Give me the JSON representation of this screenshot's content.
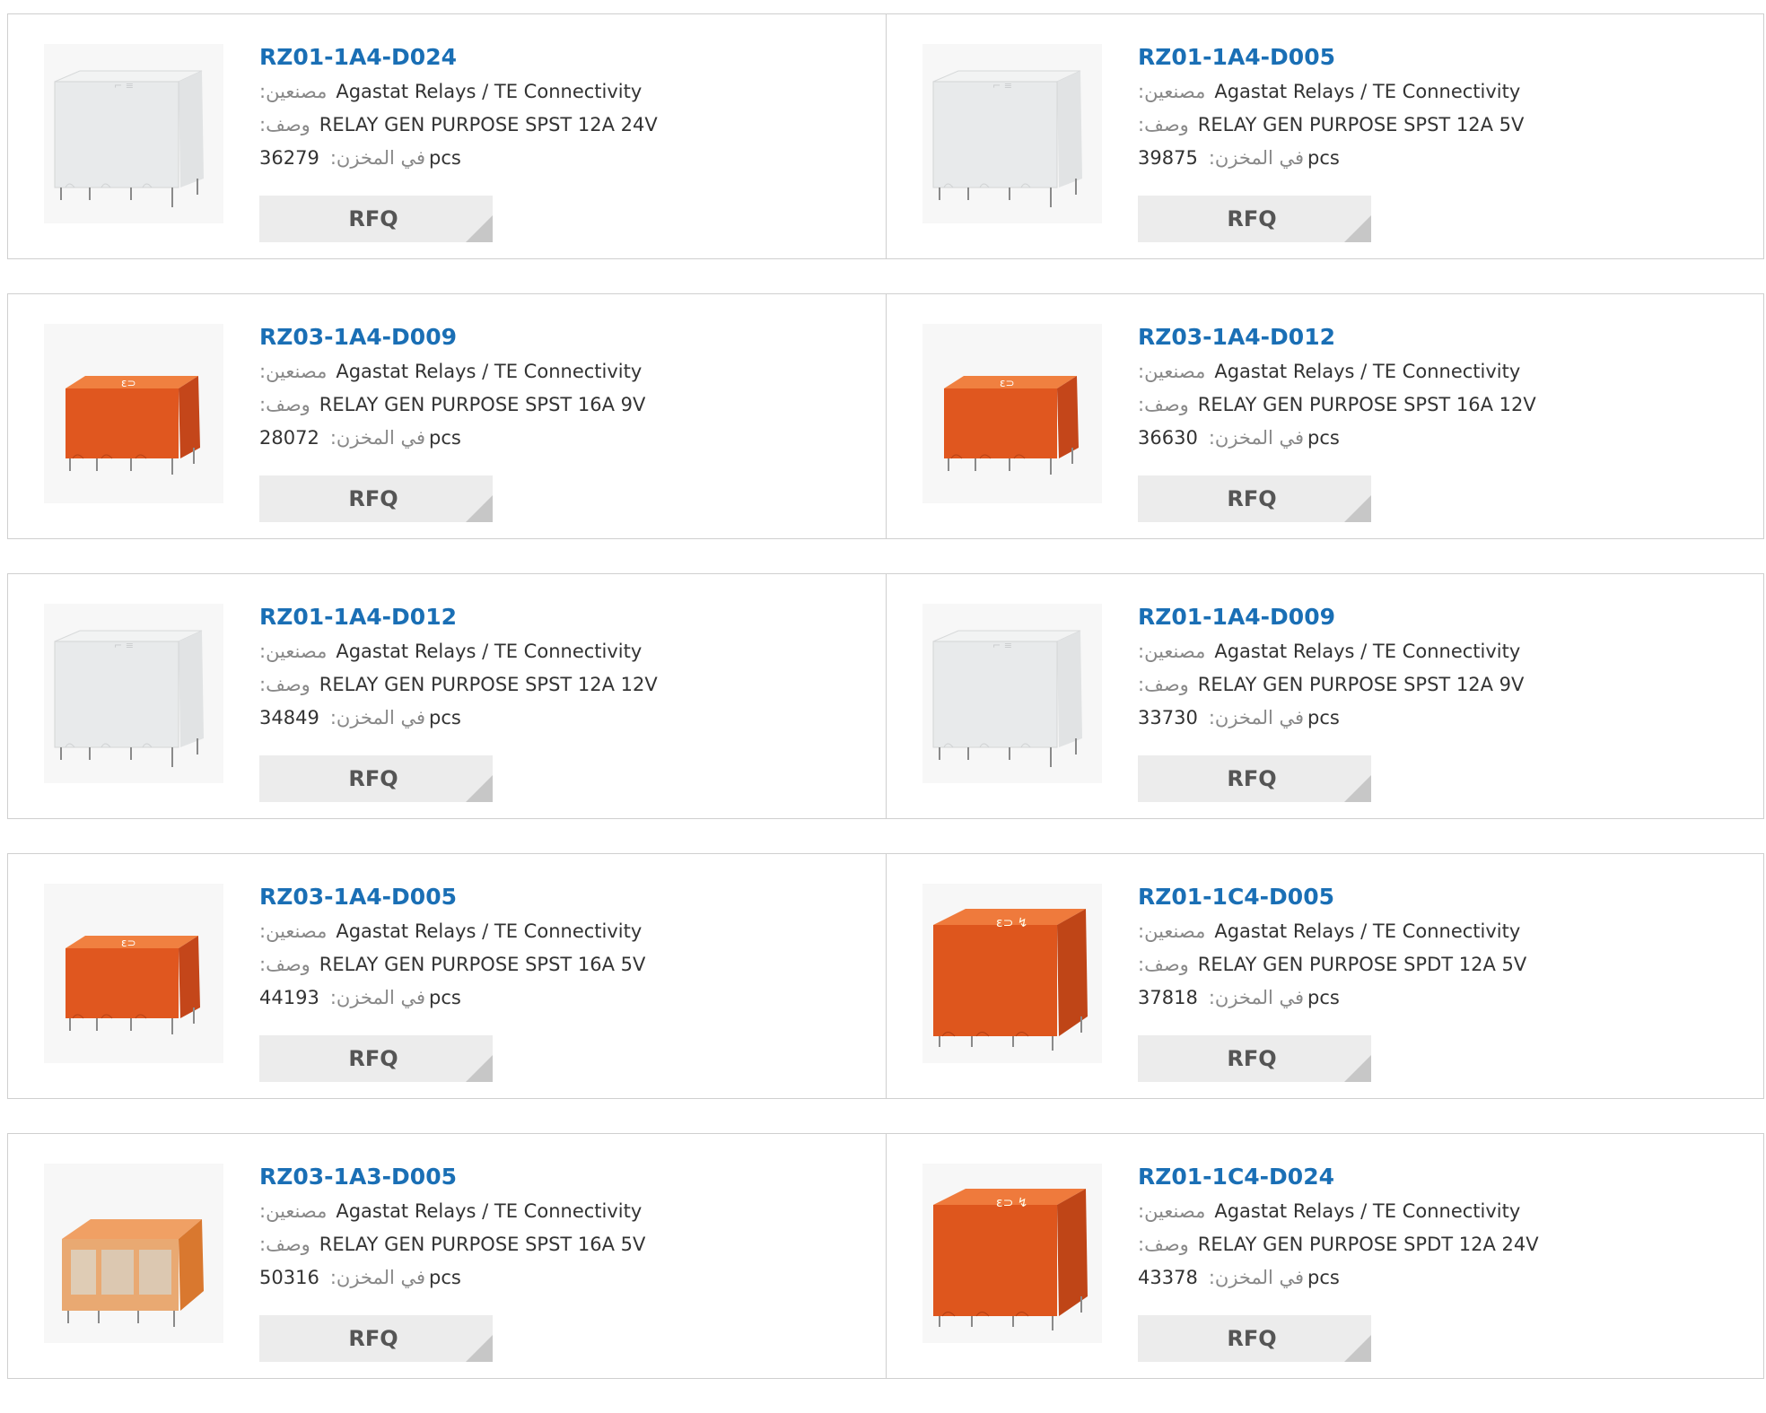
{
  "labels": {
    "manufacturer": ":مصنعين",
    "description": ":وصف",
    "in_stock": ":في المخزن",
    "pcs": "pcs",
    "rfq": "RFQ"
  },
  "products": [
    {
      "part": "RZ01-1A4-D024",
      "manufacturer": "Agastat Relays / TE Connectivity",
      "description": "RELAY GEN PURPOSE SPST 12A 24V",
      "stock": "36279",
      "image": "relay-white"
    },
    {
      "part": "RZ01-1A4-D005",
      "manufacturer": "Agastat Relays / TE Connectivity",
      "description": "RELAY GEN PURPOSE SPST 12A 5V",
      "stock": "39875",
      "image": "relay-white"
    },
    {
      "part": "RZ03-1A4-D009",
      "manufacturer": "Agastat Relays / TE Connectivity",
      "description": "RELAY GEN PURPOSE SPST 16A 9V",
      "stock": "28072",
      "image": "relay-orange-small"
    },
    {
      "part": "RZ03-1A4-D012",
      "manufacturer": "Agastat Relays / TE Connectivity",
      "description": "RELAY GEN PURPOSE SPST 16A 12V",
      "stock": "36630",
      "image": "relay-orange-small"
    },
    {
      "part": "RZ01-1A4-D012",
      "manufacturer": "Agastat Relays / TE Connectivity",
      "description": "RELAY GEN PURPOSE SPST 12A 12V",
      "stock": "34849",
      "image": "relay-white"
    },
    {
      "part": "RZ01-1A4-D009",
      "manufacturer": "Agastat Relays / TE Connectivity",
      "description": "RELAY GEN PURPOSE SPST 12A 9V",
      "stock": "33730",
      "image": "relay-white"
    },
    {
      "part": "RZ03-1A4-D005",
      "manufacturer": "Agastat Relays / TE Connectivity",
      "description": "RELAY GEN PURPOSE SPST 16A 5V",
      "stock": "44193",
      "image": "relay-orange-small"
    },
    {
      "part": "RZ01-1C4-D005",
      "manufacturer": "Agastat Relays / TE Connectivity",
      "description": "RELAY GEN PURPOSE SPDT 12A 5V",
      "stock": "37818",
      "image": "relay-orange-large"
    },
    {
      "part": "RZ03-1A3-D005",
      "manufacturer": "Agastat Relays / TE Connectivity",
      "description": "RELAY GEN PURPOSE SPST 16A 5V",
      "stock": "50316",
      "image": "relay-orange-transparent"
    },
    {
      "part": "RZ01-1C4-D024",
      "manufacturer": "Agastat Relays / TE Connectivity",
      "description": "RELAY GEN PURPOSE SPDT 12A 24V",
      "stock": "43378",
      "image": "relay-orange-large"
    }
  ]
}
